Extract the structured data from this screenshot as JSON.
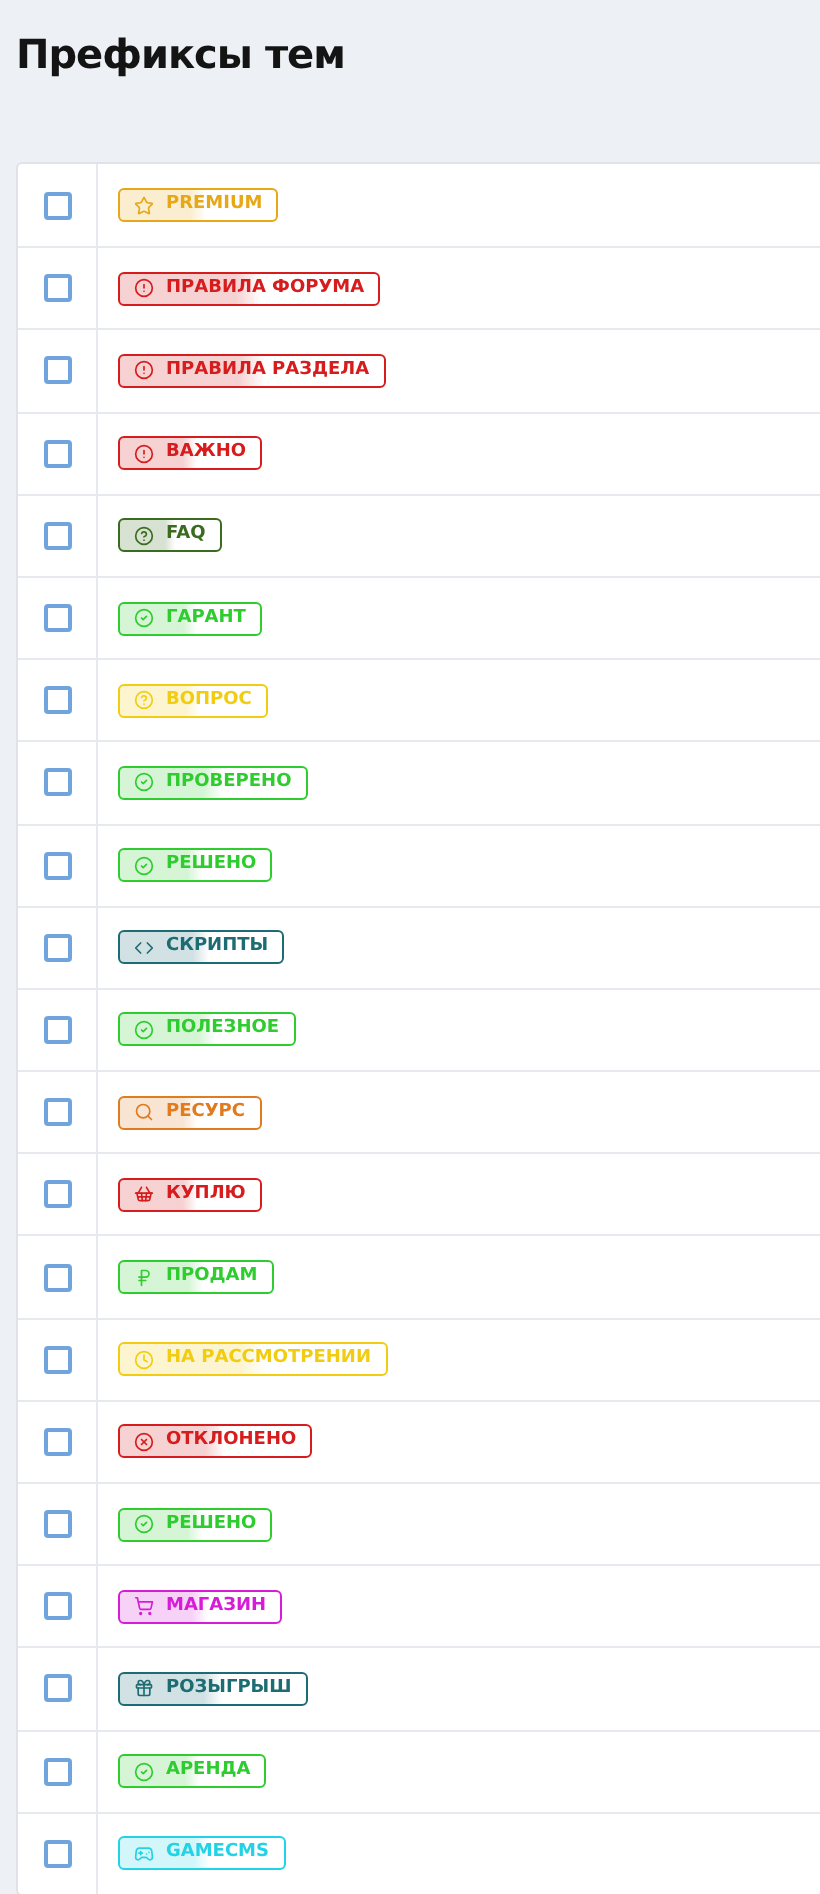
{
  "title": "Префиксы тем",
  "prefixes": [
    {
      "label": "PREMIUM",
      "kind": "star",
      "color": "#e6a817",
      "checked": false
    },
    {
      "label": "ПРАВИЛА ФОРУМА",
      "kind": "alert",
      "color": "#d61c1c",
      "checked": false
    },
    {
      "label": "ПРАВИЛА РАЗДЕЛА",
      "kind": "alert",
      "color": "#d61c1c",
      "checked": false
    },
    {
      "label": "ВАЖНО",
      "kind": "alert",
      "color": "#d61c1c",
      "checked": false
    },
    {
      "label": "FAQ",
      "kind": "help",
      "color": "#3a6b1f",
      "checked": false
    },
    {
      "label": "ГАРАНТ",
      "kind": "check",
      "color": "#2ecc2e",
      "checked": false
    },
    {
      "label": "ВОПРОС",
      "kind": "help",
      "color": "#f2cc10",
      "checked": false
    },
    {
      "label": "ПРОВЕРЕНО",
      "kind": "check",
      "color": "#2ecc2e",
      "checked": false
    },
    {
      "label": "РЕШЕНО",
      "kind": "check",
      "color": "#2ecc2e",
      "checked": false
    },
    {
      "label": "СКРИПТЫ",
      "kind": "code",
      "color": "#1d6b73",
      "checked": false
    },
    {
      "label": "ПОЛЕЗНОЕ",
      "kind": "check",
      "color": "#2ecc2e",
      "checked": false
    },
    {
      "label": "РЕСУРС",
      "kind": "search",
      "color": "#e07b20",
      "checked": false
    },
    {
      "label": "КУПЛЮ",
      "kind": "basket",
      "color": "#d61c1c",
      "checked": false
    },
    {
      "label": "ПРОДАМ",
      "kind": "ruble",
      "color": "#2ecc2e",
      "checked": false
    },
    {
      "label": "НА РАССМОТРЕНИИ",
      "kind": "clock",
      "color": "#f2cc10",
      "checked": false
    },
    {
      "label": "ОТКЛОНЕНО",
      "kind": "x",
      "color": "#d61c1c",
      "checked": false
    },
    {
      "label": "РЕШЕНО",
      "kind": "check",
      "color": "#2ecc2e",
      "checked": false
    },
    {
      "label": "МАГАЗИН",
      "kind": "cart",
      "color": "#d61cd6",
      "checked": false
    },
    {
      "label": "РОЗЫГРЫШ",
      "kind": "gift",
      "color": "#1d6b73",
      "checked": false
    },
    {
      "label": "АРЕНДА",
      "kind": "check",
      "color": "#2ecc2e",
      "checked": false
    },
    {
      "label": "GAMECMS",
      "kind": "gamepad",
      "color": "#22d3e6",
      "checked": false
    }
  ]
}
